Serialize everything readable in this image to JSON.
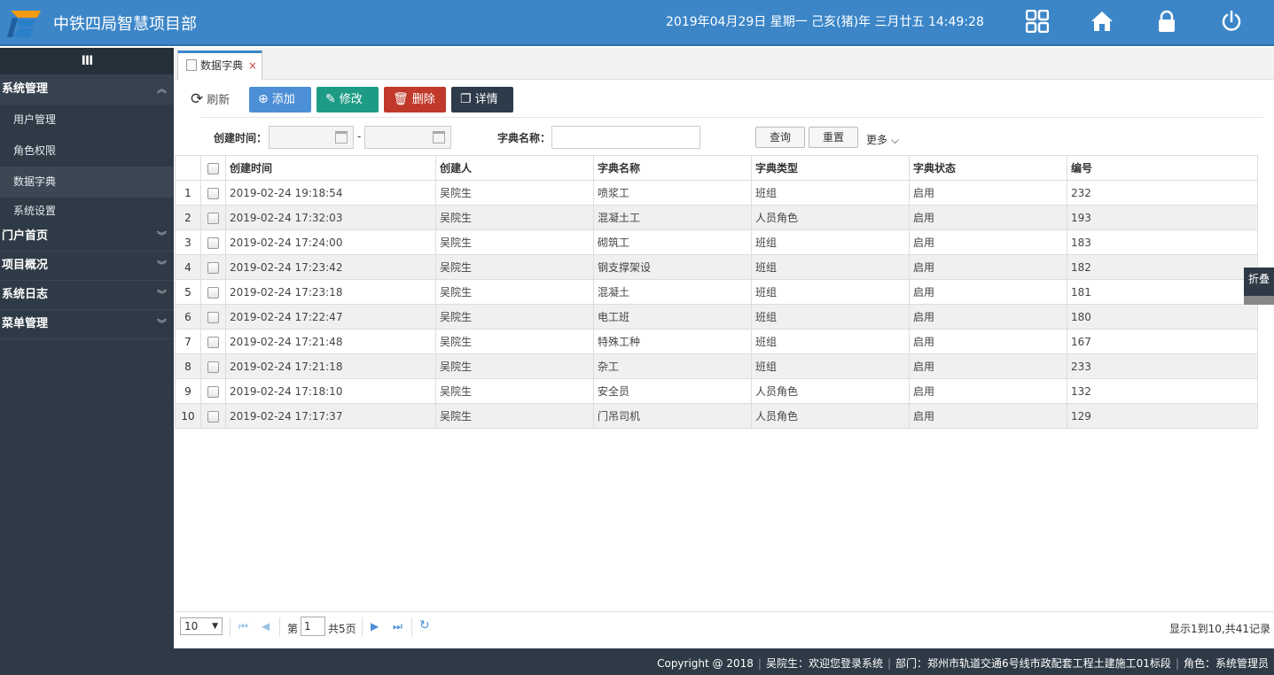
{
  "header": {
    "app_title": "中铁四局智慧项目部",
    "datetime": "2019年04月29日 星期一 己亥(猪)年 三月廿五 14:49:28"
  },
  "sidebar": {
    "toggle_label": "III",
    "groups": [
      {
        "label": "系统管理",
        "items": [
          "用户管理",
          "角色权限",
          "数据字典",
          "系统设置"
        ]
      },
      {
        "label": "门户首页"
      },
      {
        "label": "项目概况"
      },
      {
        "label": "系统日志"
      },
      {
        "label": "菜单管理"
      }
    ]
  },
  "tab": {
    "label": "数据字典",
    "close": "×"
  },
  "toolbar": {
    "refresh": "刷新",
    "add": "添加",
    "edit": "修改",
    "delete": "删除",
    "detail": "详情"
  },
  "filter": {
    "created_label": "创建时间：",
    "range_sep": "-",
    "name_label": "字典名称：",
    "query": "查询",
    "reset": "重置",
    "more": "更多 ⌵"
  },
  "table": {
    "columns": [
      "创建时间",
      "创建人",
      "字典名称",
      "字典类型",
      "字典状态",
      "编号"
    ],
    "rows": [
      {
        "idx": "1",
        "created": "2019-02-24 19:18:54",
        "creator": "吴院生",
        "name": "喷浆工",
        "type": "班组",
        "status": "启用",
        "code": "232"
      },
      {
        "idx": "2",
        "created": "2019-02-24 17:32:03",
        "creator": "吴院生",
        "name": "混凝土工",
        "type": "人员角色",
        "status": "启用",
        "code": "193"
      },
      {
        "idx": "3",
        "created": "2019-02-24 17:24:00",
        "creator": "吴院生",
        "name": "砌筑工",
        "type": "班组",
        "status": "启用",
        "code": "183"
      },
      {
        "idx": "4",
        "created": "2019-02-24 17:23:42",
        "creator": "吴院生",
        "name": "钢支撑架设",
        "type": "班组",
        "status": "启用",
        "code": "182"
      },
      {
        "idx": "5",
        "created": "2019-02-24 17:23:18",
        "creator": "吴院生",
        "name": "混凝土",
        "type": "班组",
        "status": "启用",
        "code": "181"
      },
      {
        "idx": "6",
        "created": "2019-02-24 17:22:47",
        "creator": "吴院生",
        "name": "电工班",
        "type": "班组",
        "status": "启用",
        "code": "180"
      },
      {
        "idx": "7",
        "created": "2019-02-24 17:21:48",
        "creator": "吴院生",
        "name": "特殊工种",
        "type": "班组",
        "status": "启用",
        "code": "167"
      },
      {
        "idx": "8",
        "created": "2019-02-24 17:21:18",
        "creator": "吴院生",
        "name": "杂工",
        "type": "班组",
        "status": "启用",
        "code": "233"
      },
      {
        "idx": "9",
        "created": "2019-02-24 17:18:10",
        "creator": "吴院生",
        "name": "安全员",
        "type": "人员角色",
        "status": "启用",
        "code": "132"
      },
      {
        "idx": "10",
        "created": "2019-02-24 17:17:37",
        "creator": "吴院生",
        "name": "门吊司机",
        "type": "人员角色",
        "status": "启用",
        "code": "129"
      }
    ]
  },
  "fold": {
    "label": "折叠"
  },
  "pager": {
    "page_size": "10",
    "page_prefix": "第",
    "page_value": "1",
    "page_total": "共5页",
    "info": "显示1到10,共41记录"
  },
  "footer": {
    "copyright": "Copyright @ 2018",
    "welcome": "吴院生：欢迎您登录系统",
    "dept": "部门：郑州市轨道交通6号线市政配套工程土建施工01标段",
    "role": "角色：系统管理员"
  },
  "colors": {
    "header": "#3c86c8",
    "sidebar": "#2e3a45",
    "add": "#4c8fd6",
    "edit": "#1e9b85",
    "delete": "#c0392b",
    "detail": "#2d3b4a"
  }
}
